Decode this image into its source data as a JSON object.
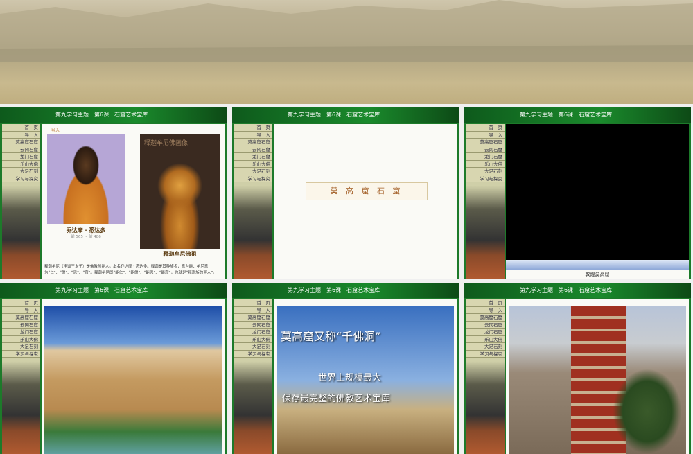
{
  "header": "第九学习主题　第6课　石窟艺术宝库",
  "nav": [
    "首　页",
    "导　入",
    "莫高窟石窟",
    "云冈石窟",
    "龙门石窟",
    "乐山大佛",
    "大足石刻",
    "学习与探究"
  ],
  "slide1": {
    "section": "导入",
    "left_caption": "乔达摩 · 悉达多",
    "left_dates": "前 565 ~ 前 486",
    "right_title": "释迦牟尼佛画像",
    "right_caption": "释迦牟尼佛祖",
    "text": "释迦牟尼（净饭王太子）是佛教创始人。本名乔达摩 · 悉达多。释迦是其种族名，意为能；牟尼意为“仁”、“儒”、“忍”、“寂”。释迦牟尼即“能仁”、“能儒”、“能忍”、“能寂”，也就是“释迦族的圣人”。"
  },
  "slide2": {
    "title": "莫 高 窟 石 窟"
  },
  "slide3": {
    "caption": "敦煌莫高窟"
  },
  "slide5": {
    "line1": "莫高窟又称“千佛洞”",
    "line2": "世界上规模最大",
    "line3": "保存最完整的佛教艺术宝库"
  }
}
